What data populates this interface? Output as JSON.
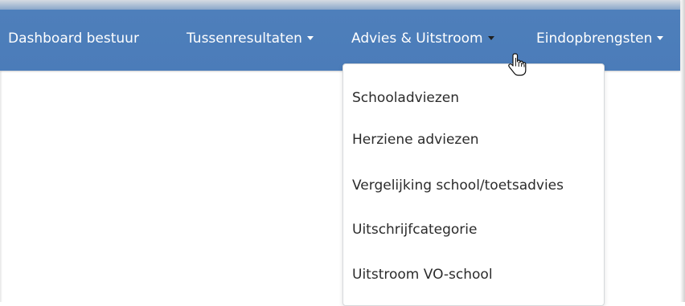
{
  "navbar": {
    "items": [
      {
        "label": "Dashboard bestuur",
        "has_caret": false
      },
      {
        "label": "Tussenresultaten",
        "has_caret": true
      },
      {
        "label": "Advies & Uitstroom",
        "has_caret": true,
        "active": true
      },
      {
        "label": "Eindopbrengsten",
        "has_caret": true
      }
    ]
  },
  "dropdown": {
    "items": [
      {
        "label": "Schooladviezen"
      },
      {
        "label": "Herziene adviezen"
      },
      {
        "label": "Vergelijking school/toetsadvies"
      },
      {
        "label": "Uitschrijfcategorie"
      },
      {
        "label": "Uitstroom VO-school"
      }
    ]
  },
  "colors": {
    "navbar_bg": "#4b7cb9",
    "nav_text": "#ffffff",
    "dropdown_text": "#2b2b2b"
  },
  "icons": {
    "cursor": "hand-pointer-icon",
    "caret": "caret-down-icon"
  }
}
